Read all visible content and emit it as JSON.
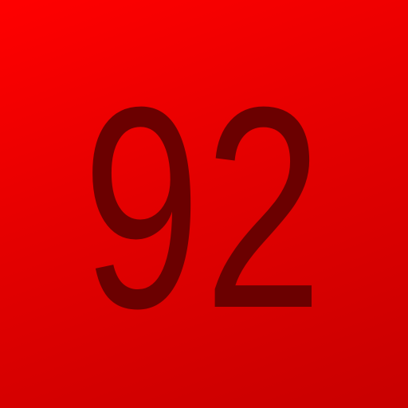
{
  "badge": {
    "number": "92",
    "background_color": "#e60000",
    "text_color": "#6b0000"
  }
}
